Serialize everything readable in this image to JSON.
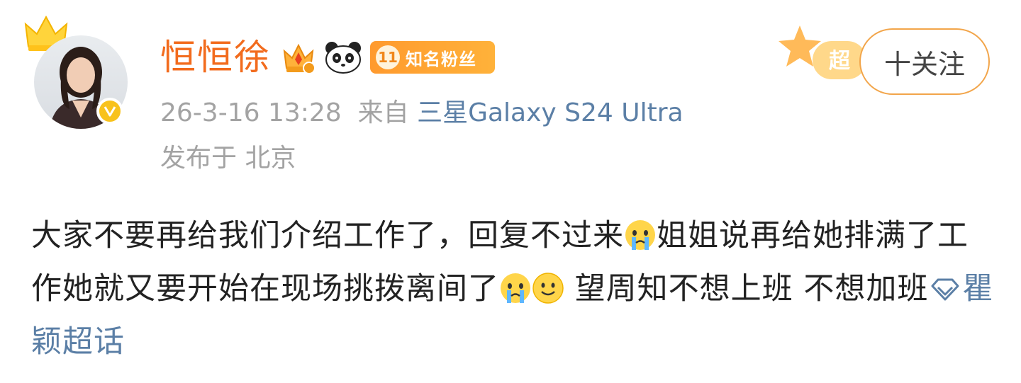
{
  "user": {
    "name": "恒恒徐",
    "fan_badge_level": "11",
    "fan_badge_text": "知名粉丝"
  },
  "meta": {
    "time": "26-3-16 13:28",
    "from_label": "来自",
    "device": "三星Galaxy S24 Ultra",
    "location": "发布于 北京"
  },
  "actions": {
    "super_tag": "超",
    "follow_label": "十关注"
  },
  "post": {
    "text1": "大家不要再给我们介绍工作了，回复不过来",
    "text2": "姐姐说再给她排满了工作她就又要开始在现场挑拨离间了",
    "text3": " 望周知不想上班 不想加班",
    "topic": "瞿颖超话"
  },
  "colors": {
    "name": "#f26b1d",
    "link": "#5b7fa6",
    "meta": "#a3a3a3",
    "badge": "#ffa530",
    "follow_border": "#f2a54a"
  },
  "icons": [
    "crown-icon",
    "verified-icon",
    "gold-crown-badge-icon",
    "panda-icon",
    "super-topic-star-icon",
    "crying-emoji-icon",
    "smile-emoji-icon",
    "super-topic-diamond-icon"
  ]
}
